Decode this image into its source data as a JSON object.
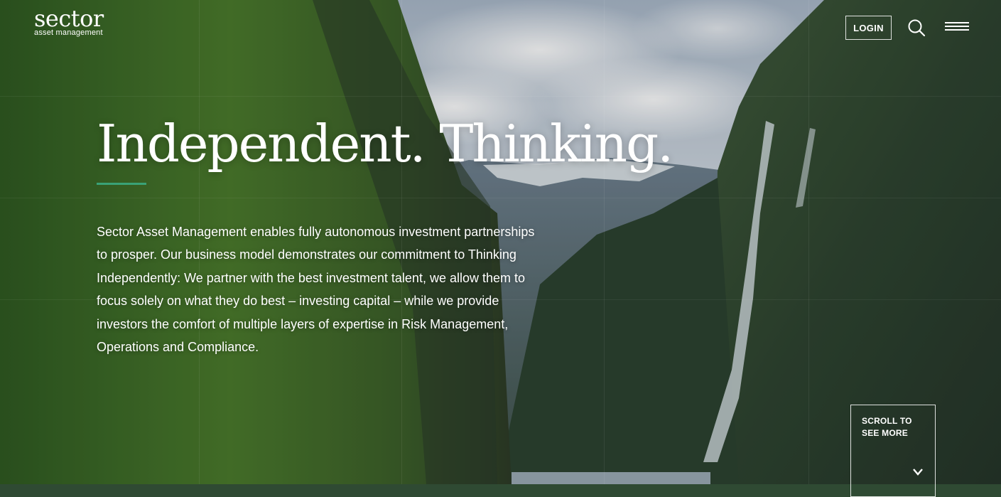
{
  "header": {
    "logo_word": "sector",
    "logo_sub": "asset management",
    "login_label": "LOGIN"
  },
  "hero": {
    "headline": "Independent. Thinking.",
    "intro": "Sector Asset Management enables fully autonomous investment partnerships to prosper. Our business model demonstrates our commitment to Thinking Independently: We partner with the best investment talent, we allow them to focus solely on what they do best – investing capital – while we provide investors the comfort of multiple layers of expertise in Risk Management, Operations and Compliance.",
    "scroll_label": "SCROLL TO SEE MORE"
  },
  "icons": {
    "search": "search-icon",
    "menu": "hamburger-menu-icon",
    "scroll": "chevron-down-icon"
  },
  "colors": {
    "accent": "#3aa277",
    "text": "#ffffff"
  }
}
